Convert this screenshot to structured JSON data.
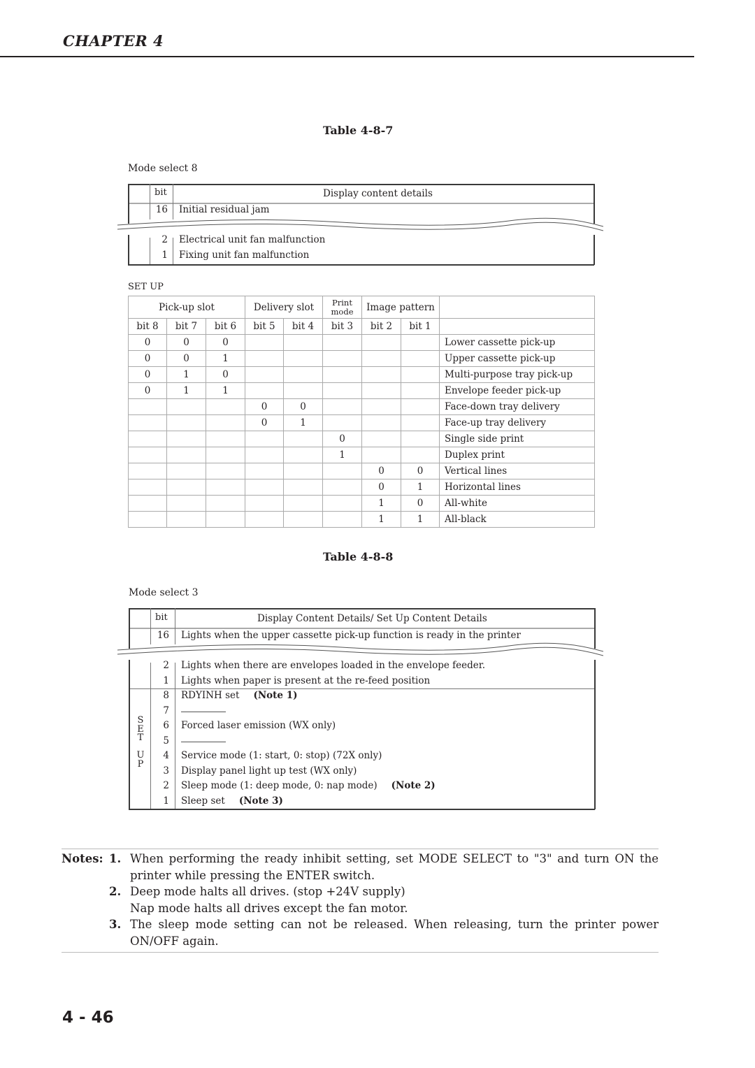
{
  "header": {
    "chapter": "CHAPTER 4"
  },
  "table_487": {
    "title": "Table 4-8-7",
    "caption": "Mode select 8",
    "header": {
      "bit": "bit",
      "details": "Display content details"
    },
    "rows_top": [
      {
        "bit": "16",
        "text": "Initial residual jam"
      }
    ],
    "rows_bottom": [
      {
        "bit": "2",
        "text": "Electrical unit fan malfunction"
      },
      {
        "bit": "1",
        "text": "Fixing unit fan malfunction"
      }
    ]
  },
  "setup_table": {
    "caption": "SET UP",
    "groups": [
      "Pick-up slot",
      "Delivery slot",
      "Print mode",
      "Image pattern"
    ],
    "print_mode_line1": "Print",
    "print_mode_line2": "mode",
    "bits": [
      "bit 8",
      "bit 7",
      "bit 6",
      "bit 5",
      "bit 4",
      "bit 3",
      "bit 2",
      "bit 1"
    ],
    "rows": [
      {
        "vals": [
          "0",
          "0",
          "0",
          "",
          "",
          "",
          "",
          ""
        ],
        "desc": "Lower cassette pick-up"
      },
      {
        "vals": [
          "0",
          "0",
          "1",
          "",
          "",
          "",
          "",
          ""
        ],
        "desc": "Upper cassette pick-up"
      },
      {
        "vals": [
          "0",
          "1",
          "0",
          "",
          "",
          "",
          "",
          ""
        ],
        "desc": "Multi-purpose tray pick-up"
      },
      {
        "vals": [
          "0",
          "1",
          "1",
          "",
          "",
          "",
          "",
          ""
        ],
        "desc": "Envelope feeder pick-up"
      },
      {
        "vals": [
          "",
          "",
          "",
          "0",
          "0",
          "",
          "",
          ""
        ],
        "desc": "Face-down tray delivery"
      },
      {
        "vals": [
          "",
          "",
          "",
          "0",
          "1",
          "",
          "",
          ""
        ],
        "desc": "Face-up tray delivery"
      },
      {
        "vals": [
          "",
          "",
          "",
          "",
          "",
          "0",
          "",
          ""
        ],
        "desc": "Single side print"
      },
      {
        "vals": [
          "",
          "",
          "",
          "",
          "",
          "1",
          "",
          ""
        ],
        "desc": "Duplex print"
      },
      {
        "vals": [
          "",
          "",
          "",
          "",
          "",
          "",
          "0",
          "0"
        ],
        "desc": "Vertical lines"
      },
      {
        "vals": [
          "",
          "",
          "",
          "",
          "",
          "",
          "0",
          "1"
        ],
        "desc": "Horizontal lines"
      },
      {
        "vals": [
          "",
          "",
          "",
          "",
          "",
          "",
          "1",
          "0"
        ],
        "desc": "All-white"
      },
      {
        "vals": [
          "",
          "",
          "",
          "",
          "",
          "",
          "1",
          "1"
        ],
        "desc": "All-black"
      }
    ]
  },
  "table_488": {
    "title": "Table 4-8-8",
    "caption": "Mode select 3",
    "header": {
      "bit": "bit",
      "details": "Display Content Details/ Set Up Content Details"
    },
    "rows_top": [
      {
        "bit": "16",
        "text": "Lights when the upper cassette pick-up function is ready in the printer"
      }
    ],
    "rows_bottom": [
      {
        "bit": "2",
        "text": "Lights when there are envelopes loaded in the envelope feeder."
      },
      {
        "bit": "1",
        "text": "Lights when paper is present at the re-feed position"
      }
    ],
    "setup_label": [
      "S",
      "E",
      "T",
      "",
      "U",
      "P"
    ],
    "setup_rows": [
      {
        "bit": "8",
        "text": "RDYINH set",
        "note": "(Note 1)"
      },
      {
        "bit": "7",
        "text": "",
        "note": "",
        "dash": true
      },
      {
        "bit": "6",
        "text": "Forced laser emission (WX only)",
        "note": ""
      },
      {
        "bit": "5",
        "text": "",
        "note": "",
        "dash": true
      },
      {
        "bit": "4",
        "text": "Service mode (1: start, 0: stop) (72X only)",
        "note": ""
      },
      {
        "bit": "3",
        "text": "Display panel light up test (WX only)",
        "note": ""
      },
      {
        "bit": "2",
        "text": "Sleep mode (1: deep mode, 0: nap mode)",
        "note": "(Note 2)"
      },
      {
        "bit": "1",
        "text": "Sleep set",
        "note": "(Note 3)"
      }
    ]
  },
  "notes": {
    "label": "Notes:",
    "items": [
      {
        "num": "1.",
        "lines": [
          "When performing the ready inhibit setting, set MODE SELECT to \"3\" and turn ON the printer while pressing the ENTER switch."
        ]
      },
      {
        "num": "2.",
        "lines": [
          "Deep mode halts all drives. (stop +24V supply)",
          "Nap mode halts all drives except the fan motor."
        ]
      },
      {
        "num": "3.",
        "lines": [
          "The sleep mode setting can not be released. When releasing, turn the printer power ON/OFF again."
        ]
      }
    ]
  },
  "footer": {
    "page_number": "4 - 46"
  }
}
